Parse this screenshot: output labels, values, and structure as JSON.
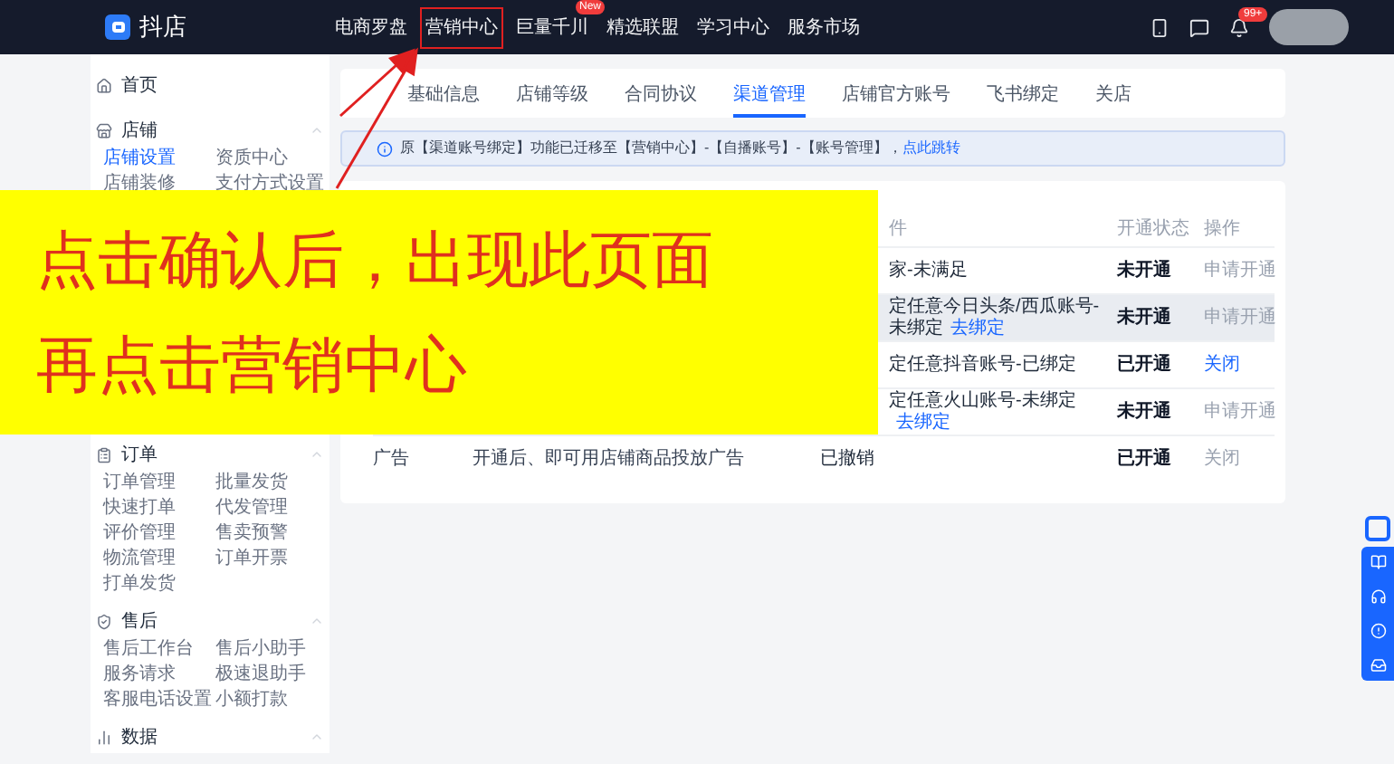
{
  "app": {
    "name": "抖店"
  },
  "nav": [
    {
      "label": "电商罗盘",
      "highlighted": false
    },
    {
      "label": "营销中心",
      "highlighted": true
    },
    {
      "label": "巨量千川",
      "highlighted": false,
      "badge": "New"
    },
    {
      "label": "精选联盟",
      "highlighted": false
    },
    {
      "label": "学习中心",
      "highlighted": false
    },
    {
      "label": "服务市场",
      "highlighted": false
    }
  ],
  "notification_badge": "99+",
  "sidebar": [
    {
      "label": "首页",
      "kind": "link"
    },
    {
      "label": "店铺",
      "kind": "group",
      "items": [
        {
          "label": "店铺设置",
          "selected": true
        },
        {
          "label": "资质中心",
          "selected": false
        },
        {
          "label": "店铺装修",
          "selected": false
        },
        {
          "label": "支付方式设置",
          "selected": false
        }
      ]
    },
    {
      "label": "订单",
      "kind": "group",
      "items": [
        {
          "label": "订单管理",
          "selected": false
        },
        {
          "label": "批量发货",
          "selected": false
        },
        {
          "label": "快速打单",
          "selected": false
        },
        {
          "label": "代发管理",
          "selected": false
        },
        {
          "label": "评价管理",
          "selected": false
        },
        {
          "label": "售卖预警",
          "selected": false
        },
        {
          "label": "物流管理",
          "selected": false
        },
        {
          "label": "订单开票",
          "selected": false
        },
        {
          "label": "打单发货",
          "selected": false
        }
      ]
    },
    {
      "label": "售后",
      "kind": "group",
      "items": [
        {
          "label": "售后工作台",
          "selected": false
        },
        {
          "label": "售后小助手",
          "selected": false
        },
        {
          "label": "服务请求",
          "selected": false
        },
        {
          "label": "极速退助手",
          "selected": false
        },
        {
          "label": "客服电话设置",
          "selected": false
        },
        {
          "label": "小额打款",
          "selected": false
        }
      ]
    },
    {
      "label": "数据",
      "kind": "group"
    }
  ],
  "tabs": [
    {
      "label": "基础信息",
      "selected": false
    },
    {
      "label": "店铺等级",
      "selected": false
    },
    {
      "label": "合同协议",
      "selected": false
    },
    {
      "label": "渠道管理",
      "selected": true
    },
    {
      "label": "店铺官方账号",
      "selected": false
    },
    {
      "label": "飞书绑定",
      "selected": false
    },
    {
      "label": "关店",
      "selected": false
    }
  ],
  "notice": {
    "text": "原【渠道账号绑定】功能已迁移至【营销中心】-【自播账号】-【账号管理】，",
    "link": "点此跳转"
  },
  "table": {
    "columns": [
      "件",
      "开通状态",
      "操作"
    ],
    "rows": [
      {
        "column_3": "家-未满足",
        "status": "未开通",
        "action": "申请开通",
        "action_active": false,
        "highlighted": false
      },
      {
        "column_3": "定任意今日头条/西瓜账号-未绑定",
        "link": "去绑定",
        "status": "未开通",
        "action": "申请开通",
        "action_active": false,
        "highlighted": true
      },
      {
        "column_3": "定任意抖音账号-已绑定",
        "status": "已开通",
        "action": "关闭",
        "action_active": true,
        "highlighted": false
      },
      {
        "column_3": "定任意火山账号-未绑定",
        "link": "去绑定",
        "status": "未开通",
        "action": "申请开通",
        "action_active": false,
        "highlighted": false
      },
      {
        "column_1": "广告",
        "column_2": "开通后、即可用店铺商品投放广告",
        "column_3": "已撤销",
        "status": "已开通",
        "action": "关闭",
        "action_active": false,
        "highlighted": false
      }
    ]
  },
  "overlay": {
    "lines": [
      "点击确认后，出现此页面",
      "再点击营销中心"
    ]
  }
}
